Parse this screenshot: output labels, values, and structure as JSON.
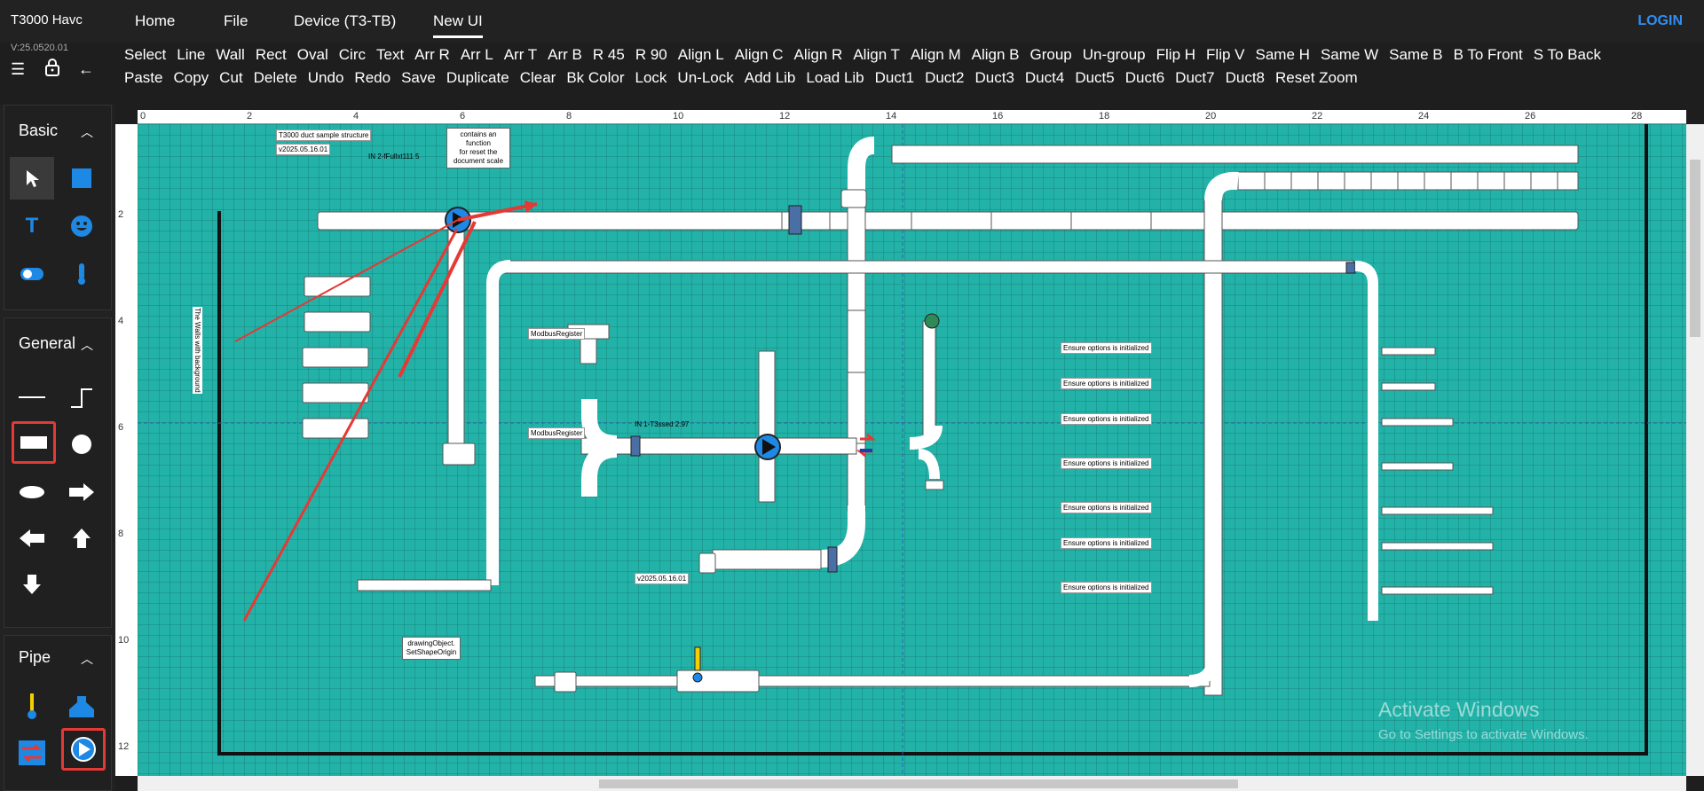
{
  "app": {
    "title": "T3000 Havc",
    "version": "V:25.0520.01"
  },
  "nav": {
    "tabs": [
      "Home",
      "File",
      "Device (T3-TB)",
      "New UI"
    ],
    "login": "LOGIN"
  },
  "toolbar": {
    "row1": [
      "Select",
      "Line",
      "Wall",
      "Rect",
      "Oval",
      "Circ",
      "Text",
      "Arr R",
      "Arr L",
      "Arr T",
      "Arr B",
      "R 45",
      "R 90",
      "Align L",
      "Align C",
      "Align R",
      "Align T",
      "Align M",
      "Align B",
      "Group",
      "Un-group",
      "Flip H",
      "Flip V",
      "Same H",
      "Same W",
      "Same B",
      "B To Front",
      "S To Back"
    ],
    "row2": [
      "Paste",
      "Copy",
      "Cut",
      "Delete",
      "Undo",
      "Redo",
      "Save",
      "Duplicate",
      "Clear",
      "Bk Color",
      "Lock",
      "Un-Lock",
      "Add Lib",
      "Load Lib",
      "Duct1",
      "Duct2",
      "Duct3",
      "Duct4",
      "Duct5",
      "Duct6",
      "Duct7",
      "Duct8",
      "Reset Zoom"
    ]
  },
  "sidebar": {
    "basic": "Basic",
    "general": "General",
    "pipe": "Pipe"
  },
  "ruler": {
    "x": [
      "0",
      "2",
      "4",
      "6",
      "8",
      "10",
      "12",
      "14",
      "16",
      "18",
      "20",
      "22",
      "24",
      "26",
      "28"
    ],
    "y": [
      "2",
      "4",
      "6",
      "8",
      "10",
      "12"
    ]
  },
  "canvas": {
    "title_label": "T3000 duct sample structure",
    "version_label": "v2025.05.16.01",
    "note_lines": [
      "contains an function",
      "for reset the",
      "document scale"
    ],
    "pump_label": "IN 2-fFullxt111 5",
    "vertical_text": "The Walls with background",
    "modbus1": "ModbusRegister",
    "modbus2": "ModbusRegister",
    "pump2_label": "IN 1-T3ssed 2.97",
    "version2": "v2025.05.16.01",
    "drawing_note_lines": [
      "drawingObject.",
      "SetShapeOrigin"
    ],
    "ensure": "Ensure options is initialized"
  },
  "watermark": {
    "line1": "Activate Windows",
    "line2": "Go to Settings to activate Windows."
  },
  "colors": {
    "canvas": "#22b2a8",
    "accent": "#2f8ff5",
    "highlight": "#e53935"
  }
}
